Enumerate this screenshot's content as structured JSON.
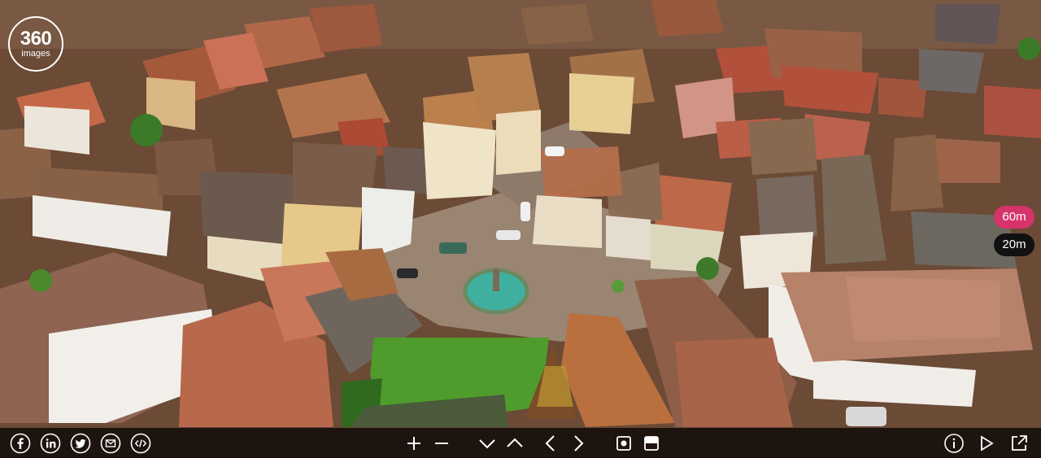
{
  "logo": {
    "number": "360",
    "word": "images"
  },
  "altitude": {
    "options": [
      "60m",
      "20m"
    ],
    "active": "60m"
  },
  "toolbar": {
    "share": [
      "facebook-icon",
      "linkedin-icon",
      "twitter-icon",
      "email-icon",
      "embed-code-icon"
    ],
    "controls": [
      "zoom-in-icon",
      "zoom-out-icon",
      "tilt-down-icon",
      "tilt-up-icon",
      "pan-left-icon",
      "pan-right-icon",
      "autorotate-icon",
      "fullscreen-view-icon"
    ],
    "info": [
      "info-icon",
      "play-icon",
      "open-external-icon"
    ]
  },
  "colors": {
    "accent": "#d6336b",
    "toolbar_bg": "#000000",
    "icon": "#ffffff"
  }
}
